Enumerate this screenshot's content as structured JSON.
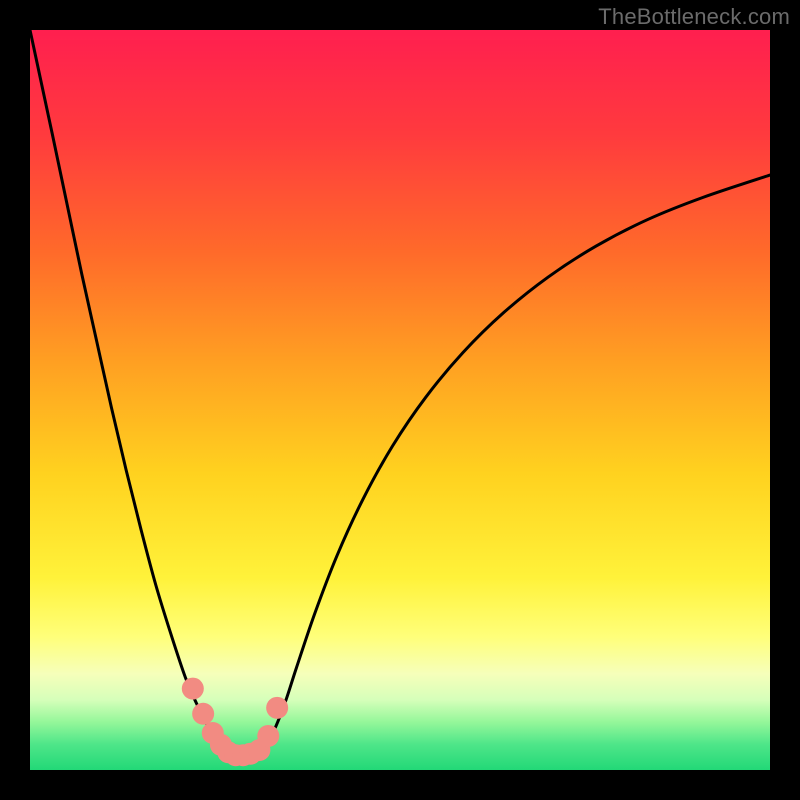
{
  "watermark": "TheBottleneck.com",
  "chart_data": {
    "type": "line",
    "title": "",
    "xlabel": "",
    "ylabel": "",
    "xlim": [
      0,
      100
    ],
    "ylim": [
      0,
      100
    ],
    "grid": false,
    "legend": false,
    "gradient": {
      "stops": [
        {
          "offset": 0.0,
          "color": "#ff1f4f"
        },
        {
          "offset": 0.14,
          "color": "#ff3a3e"
        },
        {
          "offset": 0.3,
          "color": "#ff6a2a"
        },
        {
          "offset": 0.45,
          "color": "#ffa022"
        },
        {
          "offset": 0.6,
          "color": "#ffd21f"
        },
        {
          "offset": 0.74,
          "color": "#fff23a"
        },
        {
          "offset": 0.82,
          "color": "#ffff7a"
        },
        {
          "offset": 0.87,
          "color": "#f6ffba"
        },
        {
          "offset": 0.905,
          "color": "#d6ffba"
        },
        {
          "offset": 0.935,
          "color": "#95f79a"
        },
        {
          "offset": 0.965,
          "color": "#4fe689"
        },
        {
          "offset": 1.0,
          "color": "#22d877"
        }
      ]
    },
    "curve": {
      "x": [
        0,
        1.5,
        3,
        5,
        7,
        9,
        11,
        13,
        15,
        17,
        19,
        21,
        22.5,
        24,
        25.3,
        26.2,
        27.0,
        28.0,
        29.0,
        30.0,
        31.5,
        33.0,
        34.5,
        36.0,
        38.5,
        41.5,
        45.0,
        49.0,
        53.5,
        58.5,
        64.0,
        70.0,
        76.5,
        83.5,
        91.0,
        100.0
      ],
      "y": [
        100.0,
        93.0,
        86.0,
        76.5,
        67.0,
        58.0,
        49.0,
        40.5,
        32.5,
        25.0,
        18.5,
        12.5,
        9.0,
        6.0,
        3.6,
        2.5,
        2.1,
        2.0,
        2.0,
        2.2,
        3.0,
        5.4,
        9.2,
        13.8,
        21.2,
        29.0,
        36.6,
        43.8,
        50.4,
        56.4,
        61.8,
        66.6,
        70.8,
        74.4,
        77.4,
        80.4
      ]
    },
    "markers": {
      "x": [
        22.0,
        23.4,
        24.7,
        25.8,
        26.8,
        27.8,
        28.8,
        29.8,
        31.0,
        32.2,
        33.4
      ],
      "y": [
        11.0,
        7.6,
        5.0,
        3.4,
        2.4,
        2.0,
        2.0,
        2.2,
        2.7,
        4.6,
        8.4
      ],
      "color": "#f28b82",
      "size": 11
    }
  }
}
